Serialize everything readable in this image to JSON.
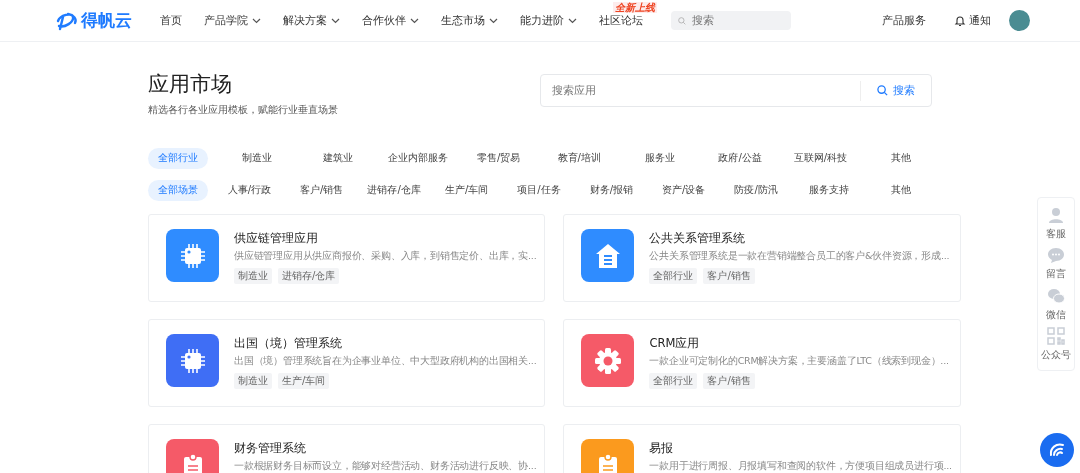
{
  "header": {
    "logo": "得帆云",
    "nav": [
      {
        "label": "首页",
        "dropdown": false
      },
      {
        "label": "产品学院",
        "dropdown": true
      },
      {
        "label": "解决方案",
        "dropdown": true
      },
      {
        "label": "合作伙伴",
        "dropdown": true
      },
      {
        "label": "生态市场",
        "dropdown": true
      },
      {
        "label": "能力进阶",
        "dropdown": true
      },
      {
        "label": "社区论坛",
        "dropdown": false,
        "badge": "全新上线"
      }
    ],
    "search": {
      "placeholder": "搜索"
    },
    "right": {
      "service": "产品服务",
      "notify": "通知"
    }
  },
  "hero": {
    "title": "应用市场",
    "subtitle": "精选各行各业应用模板，赋能行业垂直场景",
    "search": {
      "placeholder": "搜索应用",
      "button": "搜索"
    }
  },
  "filters": [
    {
      "items": [
        {
          "label": "全部行业",
          "selected": true
        },
        {
          "label": "制造业",
          "selected": false
        },
        {
          "label": "建筑业",
          "selected": false
        },
        {
          "label": "企业内部服务",
          "selected": false
        },
        {
          "label": "零售/贸易",
          "selected": false
        },
        {
          "label": "教育/培训",
          "selected": false
        },
        {
          "label": "服务业",
          "selected": false
        },
        {
          "label": "政府/公益",
          "selected": false
        },
        {
          "label": "互联网/科技",
          "selected": false
        },
        {
          "label": "其他",
          "selected": false
        }
      ]
    },
    {
      "items": [
        {
          "label": "全部场景",
          "selected": true
        },
        {
          "label": "人事/行政",
          "selected": false
        },
        {
          "label": "客户/销售",
          "selected": false
        },
        {
          "label": "进销存/仓库",
          "selected": false
        },
        {
          "label": "生产/车间",
          "selected": false
        },
        {
          "label": "项目/任务",
          "selected": false
        },
        {
          "label": "财务/报销",
          "selected": false
        },
        {
          "label": "资产/设备",
          "selected": false
        },
        {
          "label": "防疫/防汛",
          "selected": false
        },
        {
          "label": "服务支持",
          "selected": false
        },
        {
          "label": "其他",
          "selected": false
        }
      ]
    }
  ],
  "apps": [
    {
      "name": "供应链管理应用",
      "description": "供应链管理应用从供应商报价、采购、入库，到销售定价、出库，实...",
      "kind": "chip",
      "color": "#2f8cff",
      "tags": [
        "制造业",
        "进销存/仓库"
      ]
    },
    {
      "name": "公共关系管理系统",
      "description": "公共关系管理系统是一款在营销端整合员工的客户&伙伴资源，形成...",
      "kind": "house",
      "color": "#2f8cff",
      "tags": [
        "全部行业",
        "客户/销售"
      ]
    },
    {
      "name": "出国（境）管理系统",
      "description": "出国（境）管理系统旨在为企事业单位、中大型政府机构的出国相关...",
      "kind": "chip",
      "color": "#3f6ef5",
      "tags": [
        "制造业",
        "生产/车间"
      ]
    },
    {
      "name": "CRM应用",
      "description": "一款企业可定制化的CRM解决方案，主要涵盖了LTC（线索到现金）...",
      "kind": "gear",
      "color": "#f55a68",
      "tags": [
        "全部行业",
        "客户/销售"
      ]
    },
    {
      "name": "财务管理系统",
      "description": "一款根据财务目标而设立，能够对经营活动、财务活动进行反映、协...",
      "kind": "clipboard",
      "color": "#f55a68"
    },
    {
      "name": "易报",
      "description": "一款用于进行周报、月报填写和查阅的软件，方便项目组成员进行项...",
      "kind": "clipboard",
      "color": "#fb9a1e"
    }
  ],
  "side_panel": [
    {
      "label": "客服",
      "kind": "agent"
    },
    {
      "label": "留言",
      "kind": "chat"
    },
    {
      "label": "微信",
      "kind": "wechat"
    },
    {
      "label": "公众号",
      "kind": "qr"
    }
  ]
}
